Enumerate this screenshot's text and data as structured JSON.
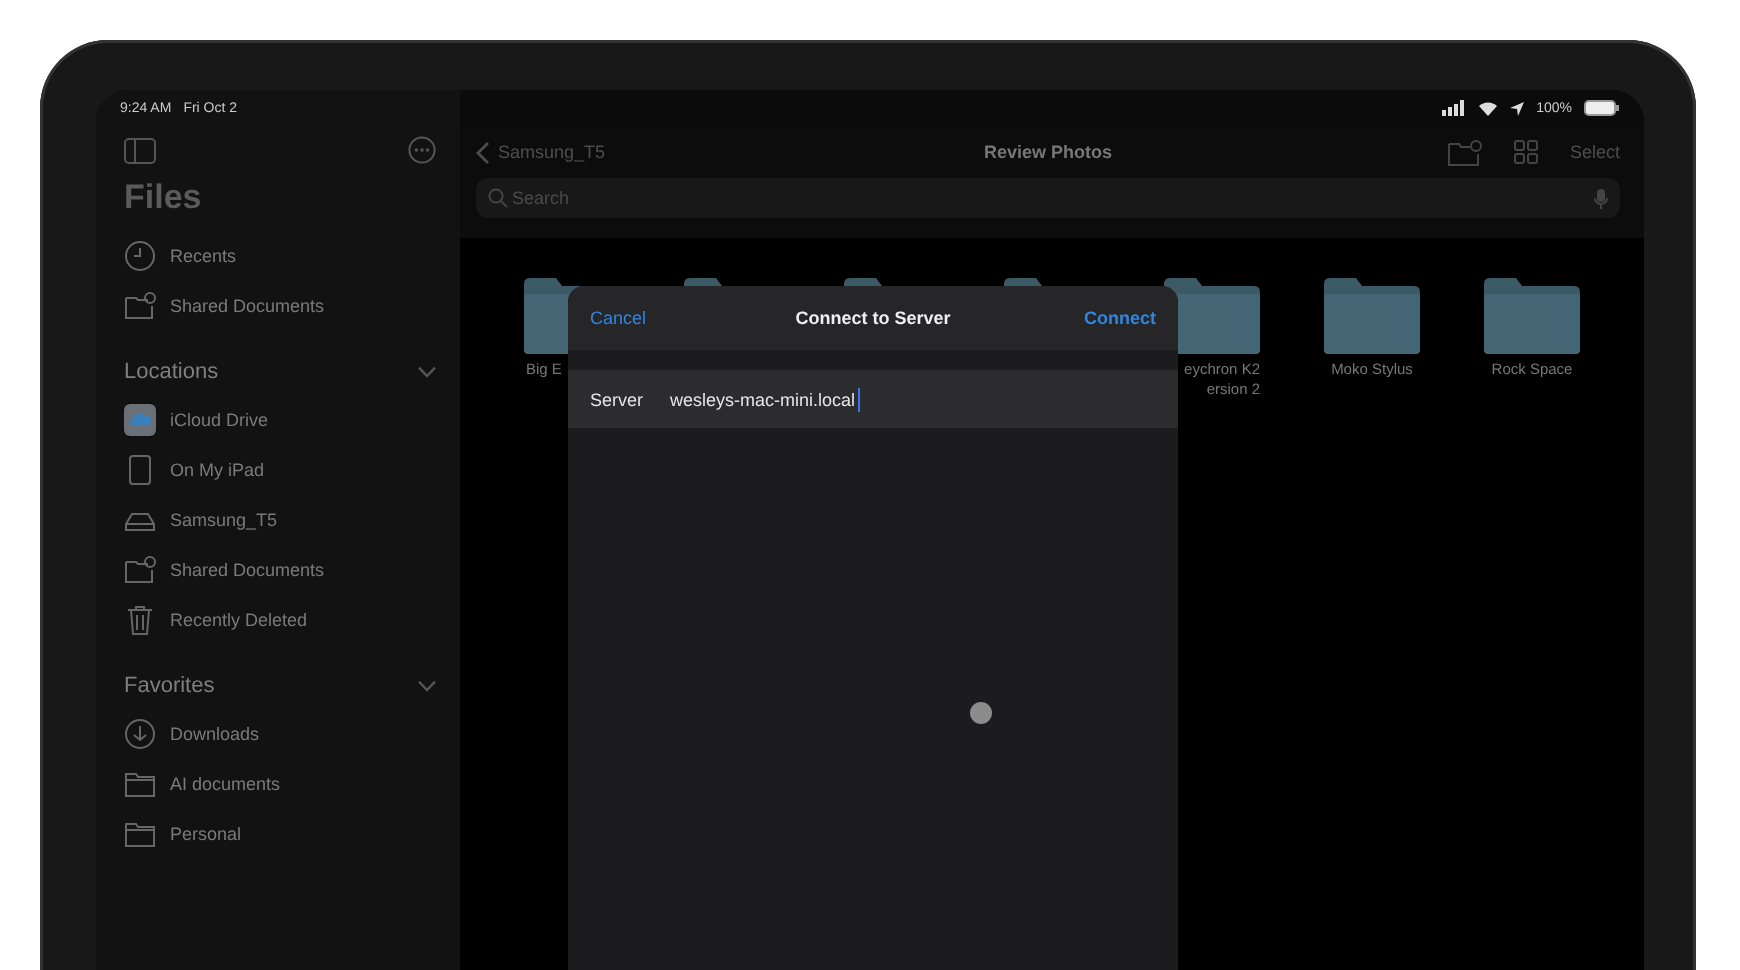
{
  "status_bar": {
    "time": "9:24 AM",
    "date": "Fri Oct 2",
    "battery": "100%"
  },
  "sidebar": {
    "title": "Files",
    "top_items": [
      {
        "label": "Recents",
        "kind": "clock"
      },
      {
        "label": "Shared Documents",
        "kind": "shared"
      }
    ],
    "sections": [
      {
        "title": "Locations",
        "expanded": true,
        "items": [
          {
            "label": "iCloud Drive",
            "kind": "cloud"
          },
          {
            "label": "On My iPad",
            "kind": "device"
          },
          {
            "label": "Samsung_T5",
            "kind": "drive"
          },
          {
            "label": "Shared Documents",
            "kind": "shared"
          },
          {
            "label": "Recently Deleted",
            "kind": "trash"
          }
        ]
      },
      {
        "title": "Favorites",
        "expanded": true,
        "items": [
          {
            "label": "Downloads",
            "kind": "download"
          },
          {
            "label": "AI documents",
            "kind": "folder"
          },
          {
            "label": "Personal",
            "kind": "folder"
          }
        ]
      }
    ]
  },
  "navigation": {
    "back": "Samsung_T5",
    "title": "Review Photos",
    "select": "Select"
  },
  "search": {
    "placeholder": "Search"
  },
  "folders": [
    {
      "kind": "truncated",
      "lines": [
        "Big E"
      ]
    },
    {
      "kind": "hidden"
    },
    {
      "kind": "hidden"
    },
    {
      "kind": "hidden"
    },
    {
      "kind": "clipped",
      "lines": [
        "eychron K2",
        "ersion 2"
      ]
    },
    {
      "kind": "whole",
      "lines": [
        "Moko Stylus"
      ]
    },
    {
      "kind": "whole",
      "lines": [
        "Rock Space"
      ]
    }
  ],
  "dialog": {
    "cancel": "Cancel",
    "title": "Connect to Server",
    "confirm": "Connect",
    "field_label": "Server",
    "value": "wesleys-mac-mini.local",
    "loading": true
  }
}
